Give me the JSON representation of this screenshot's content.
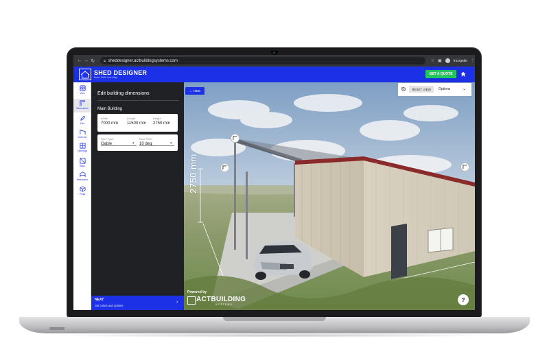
{
  "browser": {
    "url": "sheddesigner.actbuildingsystems.com",
    "incognito_label": "Incognito",
    "icons": [
      "back-icon",
      "forward-icon",
      "reload-icon",
      "star-icon",
      "sidepanel-icon",
      "incognito-avatar-icon",
      "kebab-menu-icon"
    ]
  },
  "app": {
    "title": "SHED DESIGNER",
    "tagline": "Build. Shift. Your Way.",
    "get_quote": "GET A QUOTE",
    "accent": "#1c31e6",
    "quote_color": "#22c55e"
  },
  "rail": {
    "items": [
      {
        "label": "View",
        "icon": "view-icon"
      },
      {
        "label": "Dimensions",
        "icon": "dimensions-icon"
      },
      {
        "label": "Edit",
        "icon": "pencil-icon"
      },
      {
        "label": "Lean-tos",
        "icon": "leanto-icon"
      },
      {
        "label": "Openings",
        "icon": "openings-icon"
      },
      {
        "label": "Bays",
        "icon": "bays-icon"
      },
      {
        "label": "Mezzanine",
        "icon": "mezzanine-icon"
      },
      {
        "label": "Props",
        "icon": "cube-icon"
      }
    ]
  },
  "panel": {
    "title": "Edit building dimensions",
    "section": "Main Building",
    "dimensions": {
      "width_label": "Width",
      "width_value": "7000 mm",
      "length_label": "Length",
      "length_value": "11500 mm",
      "height_label": "Height",
      "height_value": "2750 mm"
    },
    "roof": {
      "type_label": "Roof Type",
      "type_value": "Gable",
      "pitch_label": "Roof Pitch",
      "pitch_value": "10 deg"
    }
  },
  "next": {
    "title": "NEXT",
    "subtitle": "Set colors and options"
  },
  "viewport": {
    "hide": "← HIDE",
    "reset_view": "RESET VIEW",
    "options": "Options",
    "dimension_label": "2750 mm",
    "powered_by": "Powered by",
    "brand": "ACTBUILDING",
    "brand_sub": "SYSTEMS",
    "help": "?"
  }
}
